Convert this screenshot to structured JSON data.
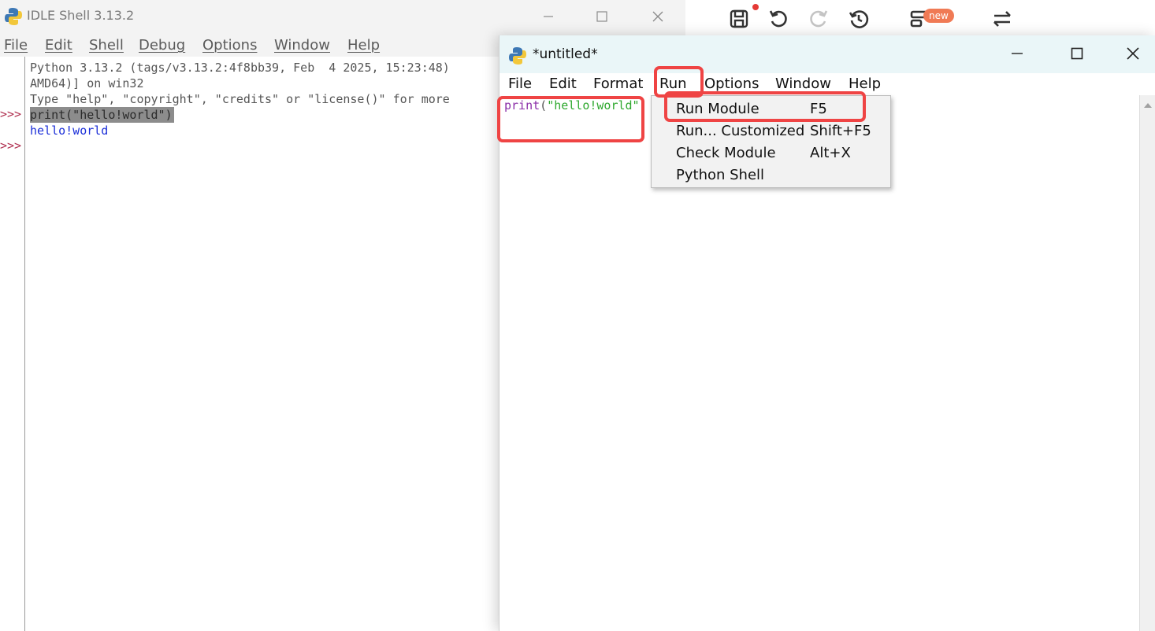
{
  "colors": {
    "annotation": "#ef4444",
    "keyword": "#8b2fa8",
    "string": "#2ea82e",
    "shell_output": "#1a2ed8",
    "prompt": "#b03050",
    "badge": "#f07a55"
  },
  "background_toolbar": {
    "icons": [
      "save-icon",
      "undo-icon",
      "redo-icon",
      "history-icon",
      "layout-icon",
      "swap-icon"
    ],
    "badge_label": "new"
  },
  "shell_window": {
    "title": "IDLE Shell 3.13.2",
    "menu": [
      "File",
      "Edit",
      "Shell",
      "Debug",
      "Options",
      "Window",
      "Help"
    ],
    "lines": [
      "Python 3.13.2 (tags/v3.13.2:4f8bb39, Feb  4 2025, 15:23:48)",
      "AMD64)] on win32",
      "Type \"help\", \"copyright\", \"credits\" or \"license()\" for more",
      "print(\"hello!world\")",
      "hello!world"
    ],
    "prompts": [
      ">>>",
      ">>>"
    ]
  },
  "editor_window": {
    "title": "*untitled*",
    "menu": [
      "File",
      "Edit",
      "Format",
      "Run",
      "Options",
      "Window",
      "Help"
    ],
    "code": {
      "keyword": "print",
      "open_paren": "(",
      "string": "\"hello!world\""
    }
  },
  "run_menu": {
    "items": [
      {
        "label": "Run Module",
        "accel": "F5"
      },
      {
        "label": "Run... Customized",
        "accel": "Shift+F5"
      },
      {
        "label": "Check Module",
        "accel": "Alt+X"
      },
      {
        "label": "Python Shell",
        "accel": ""
      }
    ]
  }
}
